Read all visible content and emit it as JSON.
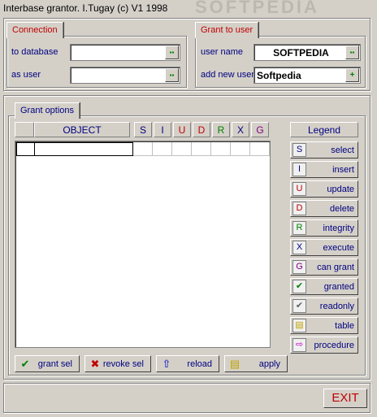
{
  "window": {
    "title": "Interbase grantor. I.Tugay (c) V1 1998",
    "watermark": "SOFTPEDIA"
  },
  "connection": {
    "title": "Connection",
    "to_database_label": "to database",
    "to_database_value": "",
    "as_user_label": "as user",
    "as_user_value": ""
  },
  "grant_to_user": {
    "title": "Grant to user",
    "user_name_label": "user name",
    "user_name_value": "SOFTPEDIA",
    "add_new_user_label": "add new user",
    "add_new_user_value": "Softpedia"
  },
  "grant_options": {
    "title": "Grant options",
    "columns": [
      {
        "label": "OBJECT",
        "color": "#000080"
      },
      {
        "label": "S",
        "color": "#000080"
      },
      {
        "label": "I",
        "color": "#000080"
      },
      {
        "label": "U",
        "color": "#c00000"
      },
      {
        "label": "D",
        "color": "#c00000"
      },
      {
        "label": "R",
        "color": "#008000"
      },
      {
        "label": "X",
        "color": "#000080"
      },
      {
        "label": "G",
        "color": "#800080"
      }
    ],
    "legend_title": "Legend",
    "legend": [
      {
        "icon": "S",
        "icon_color": "#000080",
        "label": "select"
      },
      {
        "icon": "I",
        "icon_color": "#000080",
        "label": "insert"
      },
      {
        "icon": "U",
        "icon_color": "#c00000",
        "label": "update"
      },
      {
        "icon": "D",
        "icon_color": "#c00000",
        "label": "delete"
      },
      {
        "icon": "R",
        "icon_color": "#008000",
        "label": "integrity"
      },
      {
        "icon": "X",
        "icon_color": "#000080",
        "label": "execute"
      },
      {
        "icon": "G",
        "icon_color": "#800080",
        "label": "can grant"
      },
      {
        "icon": "check-green-icon",
        "icon_color": "#008000",
        "label": "granted"
      },
      {
        "icon": "check-gray-icon",
        "icon_color": "#606060",
        "label": "readonly"
      },
      {
        "icon": "table-icon",
        "icon_color": "#c0a000",
        "label": "table"
      },
      {
        "icon": "procedure-arrow-icon",
        "icon_color": "#c000c0",
        "label": "procedure"
      }
    ]
  },
  "actions": {
    "grant_sel": "grant sel",
    "revoke_sel": "revoke sel",
    "reload": "reload",
    "apply": "apply",
    "exit": "EXIT"
  },
  "colors": {
    "face": "#d4d0c8",
    "accent_red": "#c00000",
    "label_blue": "#000080"
  }
}
